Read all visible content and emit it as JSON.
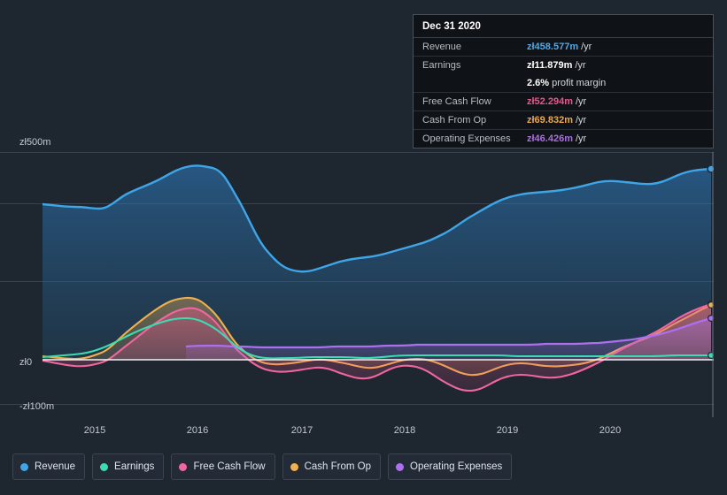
{
  "tooltip": {
    "title": "Dec 31 2020",
    "rows": [
      {
        "label": "Revenue",
        "value": "zł458.577m",
        "suffix": "/yr",
        "color": "#4fa9e8"
      },
      {
        "label": "Earnings",
        "value": "zł11.879m",
        "suffix": "/yr",
        "color": "#ffffff"
      },
      {
        "label": "",
        "value": "2.6%",
        "suffix": "profit margin",
        "color": "#ffffff"
      },
      {
        "label": "Free Cash Flow",
        "value": "zł52.294m",
        "suffix": "/yr",
        "color": "#e8568f"
      },
      {
        "label": "Cash From Op",
        "value": "zł69.832m",
        "suffix": "/yr",
        "color": "#e8a84f"
      },
      {
        "label": "Operating Expenses",
        "value": "zł46.426m",
        "suffix": "/yr",
        "color": "#a86fe0"
      }
    ]
  },
  "legend": [
    {
      "label": "Revenue",
      "color": "#3ea6e8"
    },
    {
      "label": "Earnings",
      "color": "#3ddbb0"
    },
    {
      "label": "Free Cash Flow",
      "color": "#f0679e"
    },
    {
      "label": "Cash From Op",
      "color": "#f0b04f"
    },
    {
      "label": "Operating Expenses",
      "color": "#ac6ff0"
    }
  ],
  "axis": {
    "y_ticks": [
      "zł500m",
      "zł0",
      "-zł100m"
    ],
    "x_ticks": [
      "2015",
      "2016",
      "2017",
      "2018",
      "2019",
      "2020"
    ]
  },
  "chart_data": {
    "type": "area",
    "title": "",
    "xlabel": "",
    "ylabel": "",
    "ylim": [
      -100,
      500
    ],
    "y_unit": "zł millions",
    "grid": true,
    "legend_position": "bottom-left",
    "x": [
      "2014.6",
      "2014.8",
      "2015.0",
      "2015.2",
      "2015.4",
      "2015.6",
      "2015.8",
      "2016.0",
      "2016.2",
      "2016.4",
      "2016.6",
      "2016.8",
      "2017.0",
      "2017.2",
      "2017.4",
      "2017.6",
      "2017.8",
      "2018.0",
      "2018.2",
      "2018.4",
      "2018.6",
      "2018.8",
      "2019.0",
      "2019.2",
      "2019.4",
      "2019.6",
      "2019.8",
      "2020.0",
      "2020.2",
      "2020.4",
      "2020.6",
      "2020.9"
    ],
    "series": [
      {
        "name": "Revenue",
        "color": "#3ea6e8",
        "values": [
          352,
          350,
          344,
          352,
          378,
          398,
          413,
          425,
          420,
          380,
          320,
          268,
          232,
          230,
          240,
          252,
          258,
          260,
          272,
          282,
          296,
          310,
          330,
          352,
          372,
          386,
          392,
          398,
          404,
          420,
          436,
          458.577
        ]
      },
      {
        "name": "Earnings",
        "color": "#3ddbb0",
        "values": [
          6,
          8,
          12,
          18,
          26,
          38,
          52,
          62,
          58,
          44,
          28,
          10,
          2,
          4,
          6,
          8,
          10,
          10,
          10,
          8,
          8,
          10,
          10,
          12,
          12,
          12,
          11,
          10,
          10,
          10,
          11,
          11.879
        ]
      },
      {
        "name": "Free Cash Flow",
        "color": "#f0679e",
        "values": [
          -2,
          -6,
          -12,
          -14,
          -10,
          0,
          20,
          42,
          50,
          44,
          22,
          -4,
          -22,
          -28,
          -26,
          -20,
          -16,
          -14,
          -30,
          -40,
          -30,
          -12,
          -18,
          -46,
          -70,
          -58,
          -32,
          -34,
          -30,
          0,
          30,
          52.294
        ]
      },
      {
        "name": "Cash From Op",
        "color": "#f0b04f",
        "values": [
          10,
          8,
          4,
          2,
          8,
          22,
          48,
          70,
          78,
          68,
          42,
          12,
          -8,
          -14,
          -12,
          -6,
          0,
          2,
          -12,
          -20,
          -12,
          4,
          0,
          -26,
          -48,
          -38,
          -12,
          -14,
          -10,
          18,
          46,
          69.832
        ]
      },
      {
        "name": "Operating Expenses",
        "color": "#ac6ff0",
        "values": [
          null,
          null,
          null,
          null,
          null,
          null,
          null,
          30,
          32,
          32,
          31,
          30,
          30,
          30,
          30,
          30,
          30,
          30,
          30,
          31,
          32,
          33,
          34,
          34,
          34,
          34,
          34,
          34,
          35,
          38,
          42,
          46.426
        ]
      }
    ]
  }
}
